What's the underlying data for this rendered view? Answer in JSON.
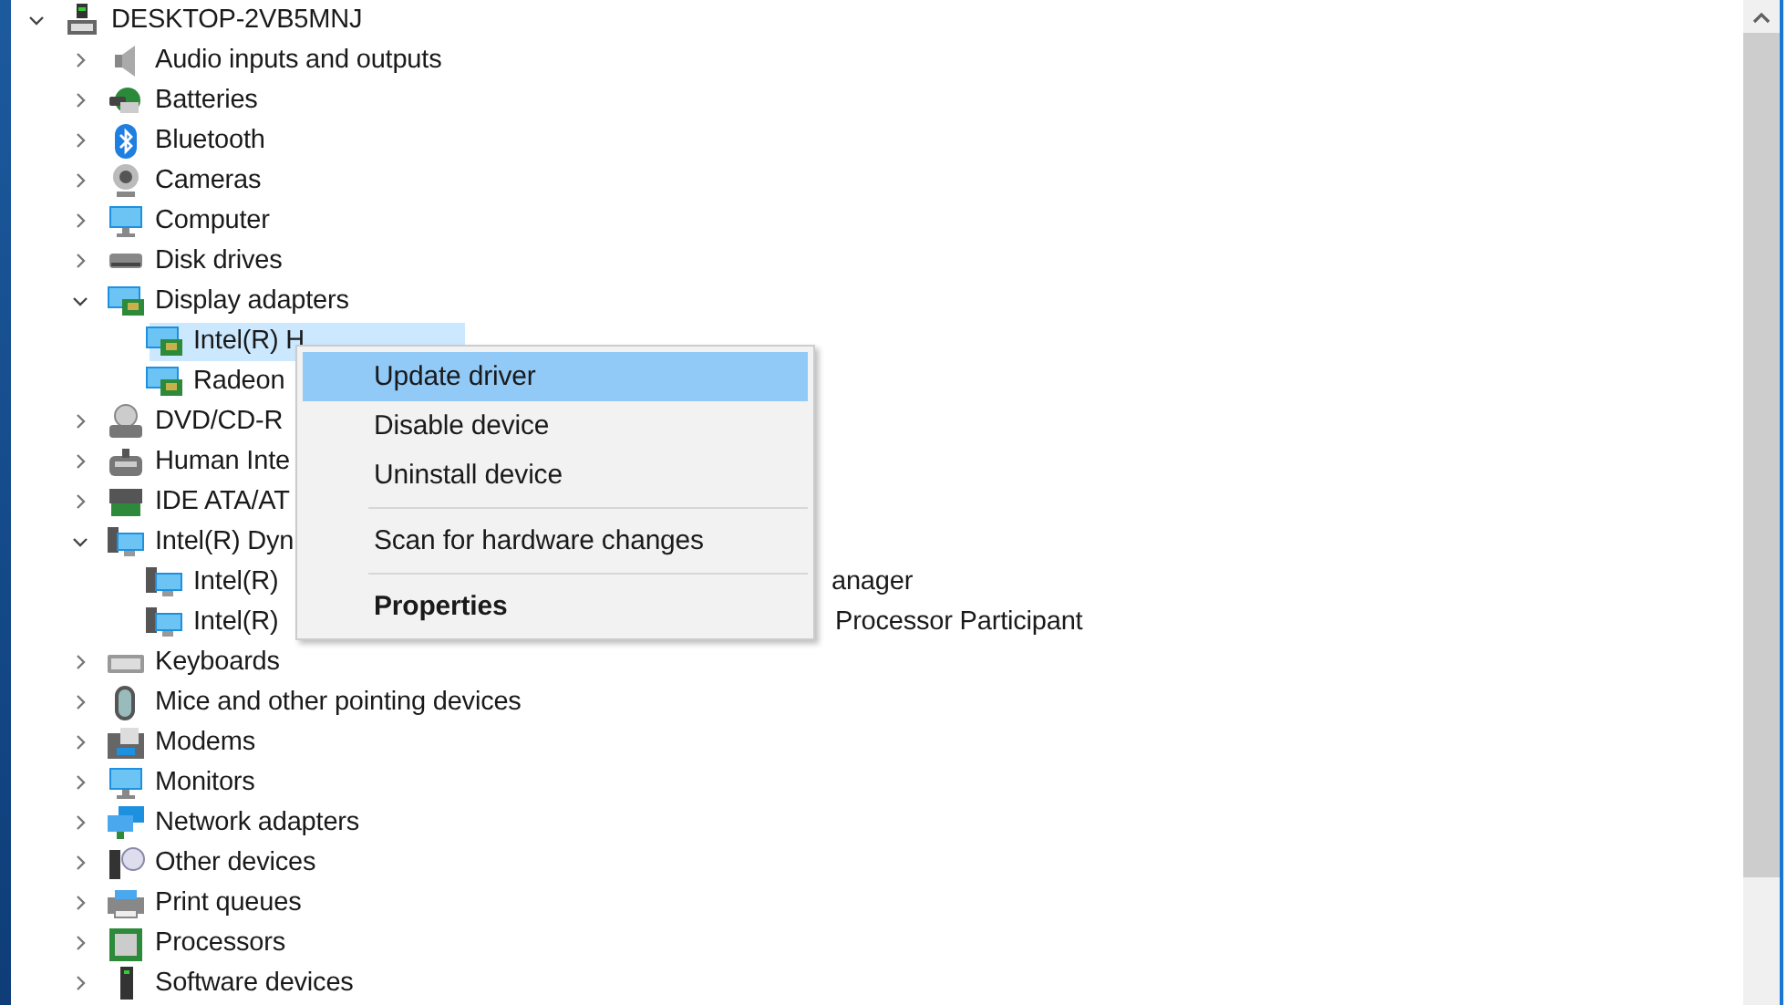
{
  "tree": {
    "label": "DESKTOP-2VB5MNJ",
    "kind": "computer",
    "expanded": true,
    "selected": false,
    "children": [
      {
        "label": "Audio inputs and outputs",
        "kind": "speaker",
        "expanded": false,
        "selected": false
      },
      {
        "label": "Batteries",
        "kind": "battery",
        "expanded": false,
        "selected": false
      },
      {
        "label": "Bluetooth",
        "kind": "bluetooth",
        "expanded": false,
        "selected": false
      },
      {
        "label": "Cameras",
        "kind": "camera",
        "expanded": false,
        "selected": false
      },
      {
        "label": "Computer",
        "kind": "monitor",
        "expanded": false,
        "selected": false
      },
      {
        "label": "Disk drives",
        "kind": "disk",
        "expanded": false,
        "selected": false
      },
      {
        "label": "Display adapters",
        "kind": "card",
        "expanded": true,
        "selected": false,
        "children": [
          {
            "label": "Intel(R) H",
            "kind": "card",
            "selected": true
          },
          {
            "label": "Radeon",
            "kind": "card",
            "selected": false
          }
        ]
      },
      {
        "label": "DVD/CD-R",
        "kind": "dvd",
        "expanded": false,
        "selected": false
      },
      {
        "label": "Human Inte",
        "kind": "hid",
        "expanded": false,
        "selected": false
      },
      {
        "label": "IDE ATA/AT",
        "kind": "ide",
        "expanded": false,
        "selected": false
      },
      {
        "label": "Intel(R) Dyn",
        "kind": "system",
        "expanded": true,
        "selected": false,
        "children": [
          {
            "label": "Intel(R)",
            "tail": "anager",
            "kind": "system",
            "selected": false
          },
          {
            "label": "Intel(R)",
            "tail": "Processor Participant",
            "kind": "system",
            "selected": false
          }
        ]
      },
      {
        "label": "Keyboards",
        "kind": "keyboard",
        "expanded": false,
        "selected": false
      },
      {
        "label": "Mice and other pointing devices",
        "kind": "mouse",
        "expanded": false,
        "selected": false
      },
      {
        "label": "Modems",
        "kind": "modem",
        "expanded": false,
        "selected": false
      },
      {
        "label": "Monitors",
        "kind": "monitor",
        "expanded": false,
        "selected": false
      },
      {
        "label": "Network adapters",
        "kind": "network",
        "expanded": false,
        "selected": false
      },
      {
        "label": "Other devices",
        "kind": "other",
        "expanded": false,
        "selected": false
      },
      {
        "label": "Print queues",
        "kind": "printer",
        "expanded": false,
        "selected": false
      },
      {
        "label": "Processors",
        "kind": "processor",
        "expanded": false,
        "selected": false
      },
      {
        "label": "Software devices",
        "kind": "software",
        "expanded": false,
        "selected": false
      }
    ]
  },
  "context_menu": [
    {
      "label": "Update driver",
      "selected": true,
      "separator_before": false,
      "default": false
    },
    {
      "label": "Disable device",
      "selected": false,
      "separator_before": false,
      "default": false
    },
    {
      "label": "Uninstall device",
      "selected": false,
      "separator_before": false,
      "default": false
    },
    {
      "label": "Scan for hardware changes",
      "selected": false,
      "separator_before": true,
      "default": false
    },
    {
      "label": "Properties",
      "selected": false,
      "separator_before": true,
      "default": true
    }
  ]
}
